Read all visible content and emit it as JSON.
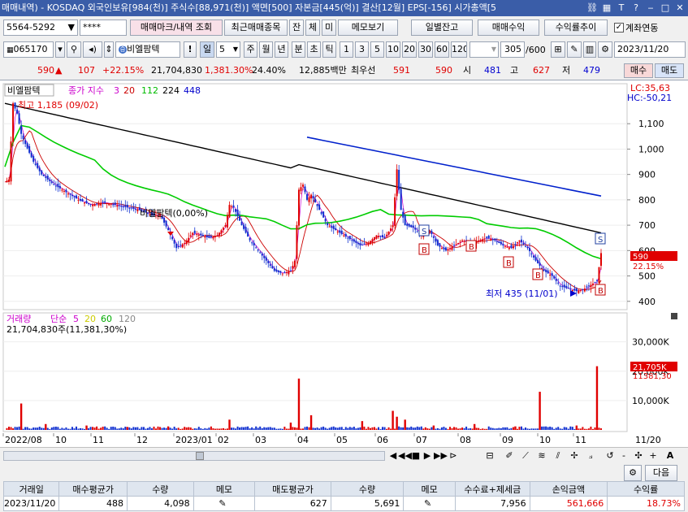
{
  "titlebar": {
    "text": "매매내역) - KOSDAQ 외국인보유[984(천)] 주식수[88,971(천)] 액면[500] 자본금[445(억)] 결산[12월] EPS[-156] 시가총액[5"
  },
  "toolbar1": {
    "account": "5564-5292",
    "password": "****",
    "btn_trade": "매매마크/내역 조회",
    "btn_recent": "최근매매종목",
    "btn_jan": "잔",
    "btn_che": "체",
    "btn_mi": "미",
    "btn_memo": "메모보기",
    "btn_daily": "일별잔고",
    "btn_profit": "매매수익",
    "btn_trend": "수익률추이",
    "chk_account": "계좌연동"
  },
  "toolbar2": {
    "code": "065170",
    "name": "비엘팜텍",
    "excl": "!",
    "period_il": "일",
    "period_n": "5",
    "periods": [
      "주",
      "월",
      "년",
      "분",
      "초",
      "틱"
    ],
    "nums": [
      "1",
      "3",
      "5",
      "10",
      "20",
      "30",
      "60",
      "120"
    ],
    "count": "305",
    "total": "/600",
    "date": "2023/11/20"
  },
  "info": {
    "price": "590",
    "arrow": "▲",
    "change": "107",
    "change_pct": "+22.15%",
    "volume": "21,704,830",
    "vol_pct": "1,381.30%",
    "turnover": "24.40%",
    "amount": "12,885백만",
    "uptick_label": "최우선",
    "best_ask": "591",
    "best_bid": "590",
    "open_label": "시",
    "open": "481",
    "high_label": "고",
    "high": "627",
    "low_label": "저",
    "low": "479",
    "buy": "매수",
    "sell": "매도"
  },
  "chart_data": {
    "type": "candlestick",
    "title": "비엘팜텍",
    "ma_label": "종가 지수",
    "ma_periods": [
      "3",
      "20",
      "112",
      "224",
      "448"
    ],
    "ma_colors": [
      "#cc00cc",
      "#cc0000",
      "#00bb00",
      "#000000",
      "#0000cc"
    ],
    "lc": "LC:35,63",
    "hc": "HC:-50,21",
    "high_annot": "최고 1,185 (09/02)",
    "mid_annot": "비엘팜텍(0,00%)",
    "low_annot": "최저 435 (11/01)",
    "last_price_tag": "590",
    "last_pct_tag": "22.15%",
    "price_ylim": [
      380,
      1200
    ],
    "price_ticks": [
      "1,100",
      "1,000",
      "900",
      "800",
      "700",
      "600",
      "500",
      "400"
    ],
    "price_tick_values": [
      1100,
      1000,
      900,
      800,
      700,
      600,
      500,
      400
    ],
    "x_labels": [
      "2022/08",
      "10",
      "11",
      "12",
      "2023/01",
      "02",
      "03",
      "04",
      "05",
      "06",
      "07",
      "08",
      "09",
      "10",
      "11",
      "11/20"
    ],
    "price_path": [
      [
        0,
        870
      ],
      [
        2,
        880
      ],
      [
        4,
        1180
      ],
      [
        6,
        1140
      ],
      [
        8,
        1060
      ],
      [
        10,
        1020
      ],
      [
        14,
        950
      ],
      [
        18,
        900
      ],
      [
        24,
        860
      ],
      [
        30,
        830
      ],
      [
        36,
        800
      ],
      [
        42,
        780
      ],
      [
        48,
        790
      ],
      [
        54,
        780
      ],
      [
        60,
        770
      ],
      [
        66,
        760
      ],
      [
        72,
        740
      ],
      [
        76,
        740
      ],
      [
        80,
        680
      ],
      [
        84,
        610
      ],
      [
        88,
        630
      ],
      [
        92,
        670
      ],
      [
        96,
        660
      ],
      [
        100,
        650
      ],
      [
        104,
        660
      ],
      [
        108,
        700
      ],
      [
        110,
        780
      ],
      [
        112,
        770
      ],
      [
        116,
        700
      ],
      [
        120,
        640
      ],
      [
        124,
        600
      ],
      [
        128,
        560
      ],
      [
        132,
        520
      ],
      [
        136,
        510
      ],
      [
        140,
        520
      ],
      [
        142,
        560
      ],
      [
        144,
        840
      ],
      [
        146,
        860
      ],
      [
        148,
        800
      ],
      [
        150,
        820
      ],
      [
        154,
        760
      ],
      [
        158,
        700
      ],
      [
        162,
        680
      ],
      [
        166,
        660
      ],
      [
        170,
        640
      ],
      [
        174,
        620
      ],
      [
        178,
        630
      ],
      [
        182,
        660
      ],
      [
        186,
        650
      ],
      [
        190,
        700
      ],
      [
        192,
        920
      ],
      [
        194,
        760
      ],
      [
        196,
        700
      ],
      [
        200,
        690
      ],
      [
        204,
        660
      ],
      [
        208,
        680
      ],
      [
        212,
        620
      ],
      [
        216,
        600
      ],
      [
        220,
        620
      ],
      [
        224,
        640
      ],
      [
        228,
        630
      ],
      [
        232,
        640
      ],
      [
        236,
        650
      ],
      [
        240,
        640
      ],
      [
        244,
        620
      ],
      [
        248,
        610
      ],
      [
        252,
        640
      ],
      [
        256,
        610
      ],
      [
        260,
        560
      ],
      [
        264,
        520
      ],
      [
        268,
        500
      ],
      [
        272,
        460
      ],
      [
        276,
        450
      ],
      [
        280,
        440
      ],
      [
        284,
        450
      ],
      [
        288,
        470
      ],
      [
        290,
        480
      ],
      [
        292,
        590
      ]
    ],
    "volume_panel": {
      "label": "거래량",
      "ma_label": "단순",
      "ma_periods": [
        "5",
        "20",
        "60",
        "120"
      ],
      "ma_colors": [
        "#cc00cc",
        "#cccc00",
        "#00aa00",
        "#888888"
      ],
      "last_volume": "21,704,830주(11,381,30%)",
      "ylim": [
        0,
        36000
      ],
      "ticks": [
        "30,000K",
        "20,000K",
        "10,000K"
      ],
      "tick_values": [
        30000,
        20000,
        10000
      ],
      "last_tag": "21,705K",
      "last_pct_tag": "11381,30",
      "spikes": [
        [
          8,
          9000
        ],
        [
          20,
          2000
        ],
        [
          40,
          1500
        ],
        [
          60,
          1000
        ],
        [
          80,
          1200
        ],
        [
          110,
          3500
        ],
        [
          140,
          2500
        ],
        [
          144,
          17500
        ],
        [
          150,
          5000
        ],
        [
          175,
          3000
        ],
        [
          190,
          6500
        ],
        [
          192,
          4500
        ],
        [
          196,
          3500
        ],
        [
          210,
          1500
        ],
        [
          230,
          2000
        ],
        [
          250,
          1200
        ],
        [
          262,
          13000
        ],
        [
          280,
          1500
        ],
        [
          290,
          21705
        ]
      ]
    }
  },
  "bottombar": {
    "play_prev": "◀",
    "stop": "■",
    "play_next": "▶",
    "zoom_minus": "-",
    "zoom_plus": "+",
    "font_a": "A"
  },
  "grid": {
    "next_btn": "다음",
    "headers": [
      "거래일",
      "매수평균가",
      "수량",
      "메모",
      "매도평균가",
      "수량",
      "메모",
      "수수료+제세금",
      "손익금액",
      "수익률"
    ],
    "rows": [
      [
        "2023/11/20",
        "488",
        "4,098",
        "✎",
        "627",
        "5,691",
        "✎",
        "7,956",
        "561,666",
        "18.73%"
      ]
    ]
  }
}
